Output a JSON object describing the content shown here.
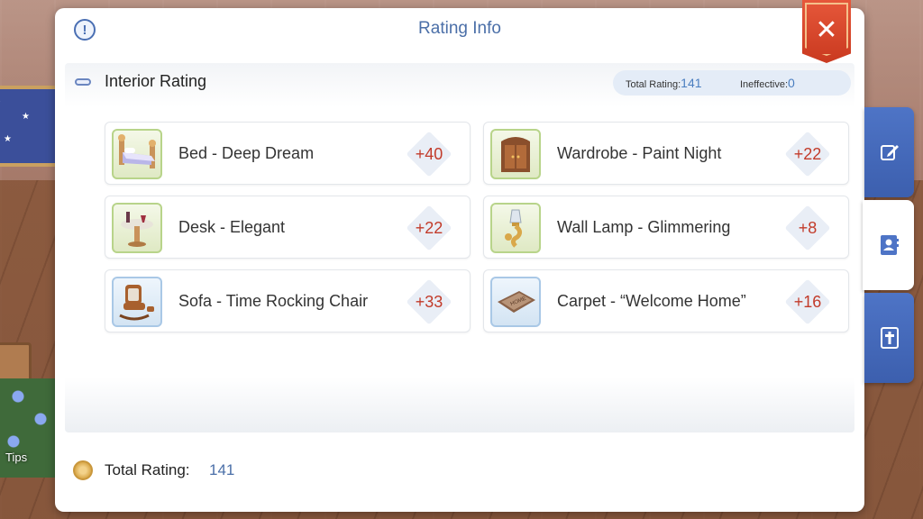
{
  "background": {
    "tips_label": "Tips"
  },
  "panel": {
    "title": "Rating Info",
    "close_icon": "close-icon",
    "info_icon": "info-icon"
  },
  "section": {
    "title": "Interior Rating",
    "total_rating_label": "Total Rating:",
    "total_rating_value": "141",
    "ineffective_label": "Ineffective:",
    "ineffective_value": "0"
  },
  "items": [
    {
      "name": "Bed - Deep Dream",
      "score": "+40",
      "icon": "bed-icon"
    },
    {
      "name": "Wardrobe - Paint Night",
      "score": "+22",
      "icon": "wardrobe-icon"
    },
    {
      "name": "Desk - Elegant",
      "score": "+22",
      "icon": "desk-icon"
    },
    {
      "name": "Wall Lamp - Glimmering",
      "score": "+8",
      "icon": "wall-lamp-icon"
    },
    {
      "name": "Sofa - Time Rocking Chair",
      "score": "+33",
      "icon": "rocking-chair-icon"
    },
    {
      "name": "Carpet - “Welcome Home”",
      "score": "+16",
      "icon": "carpet-icon"
    }
  ],
  "footer": {
    "label": "Total Rating:",
    "value": "141"
  },
  "side_tabs": [
    {
      "icon": "edit-icon",
      "active": false
    },
    {
      "icon": "contacts-book-icon",
      "active": true
    },
    {
      "icon": "cross-book-icon",
      "active": false
    }
  ],
  "colors": {
    "accent_blue": "#4b6fa8",
    "score_red": "#c23b2a",
    "close_red": "#d9472b",
    "tab_blue": "#4e74c6"
  }
}
